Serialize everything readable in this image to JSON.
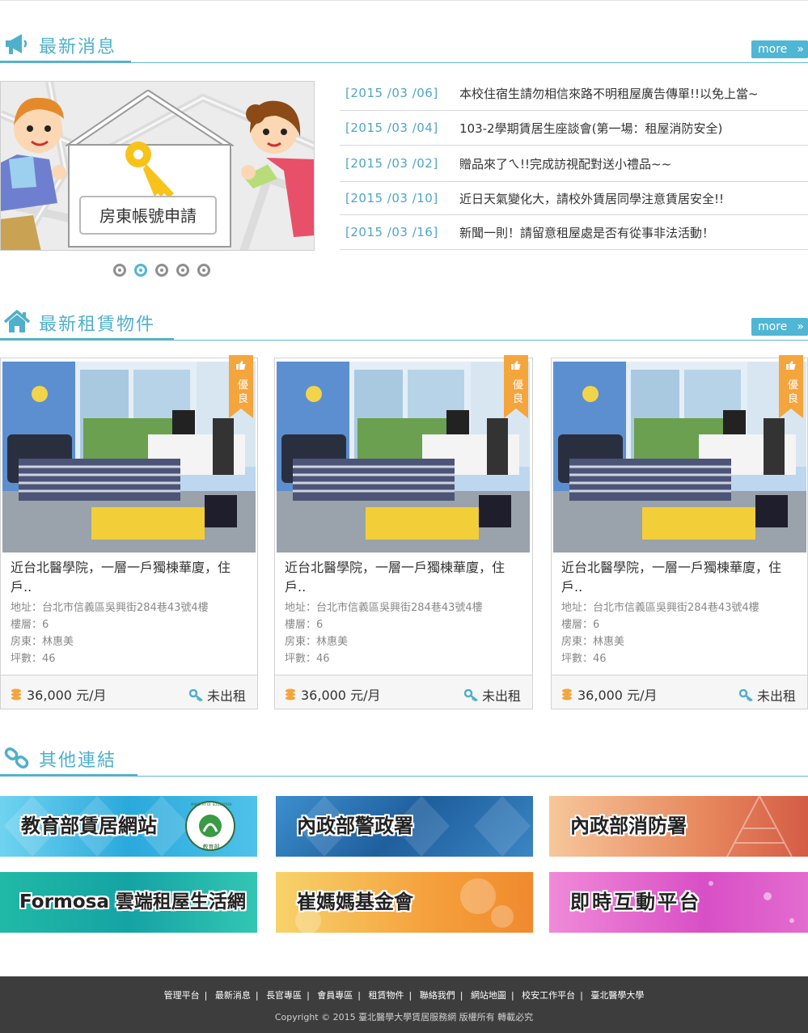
{
  "news_section": {
    "title": "最新消息",
    "more": "more",
    "banner": {
      "caption": "房東帳號申請"
    },
    "slider_dots": 5,
    "active_dot": 2,
    "items": [
      {
        "date": "[2015 /03 /06]",
        "text": "本校住宿生請勿相信來路不明租屋廣告傳單!!以免上當~"
      },
      {
        "date": "[2015 /03 /04]",
        "text": "103-2學期賃居生座談會(第一場：租屋消防安全)"
      },
      {
        "date": "[2015 /03 /02]",
        "text": "贈品來了ㄟ!!完成訪視配對送小禮品~~"
      },
      {
        "date": "[2015 /03 /10]",
        "text": "近日天氣變化大，請校外賃居同學注意賃居安全!!"
      },
      {
        "date": "[2015 /03 /16]",
        "text": "新聞一則！請留意租屋處是否有從事非法活動！"
      }
    ]
  },
  "rental_section": {
    "title": "最新租賃物件",
    "more": "more",
    "listings": [
      {
        "badge": [
          "優",
          "良"
        ],
        "title_line1": "近台北醫學院，一層一戶獨棟華廈，住",
        "title_line2": "戶..",
        "address": "地址：台北市信義區吳興街284巷43號4樓",
        "floor": "樓層：6",
        "landlord": "房東：林惠美",
        "area": "坪數：46",
        "price": "36,000 元/月",
        "status": "未出租"
      },
      {
        "badge": [
          "優",
          "良"
        ],
        "title_line1": "近台北醫學院，一層一戶獨棟華廈，住",
        "title_line2": "戶..",
        "address": "地址：台北市信義區吳興街284巷43號4樓",
        "floor": "樓層：6",
        "landlord": "房東：林惠美",
        "area": "坪數：46",
        "price": "36,000 元/月",
        "status": "未出租"
      },
      {
        "badge": [
          "優",
          "良"
        ],
        "title_line1": "近台北醫學院，一層一戶獨棟華廈，住",
        "title_line2": "戶..",
        "address": "地址：台北市信義區吳興街284巷43號4樓",
        "floor": "樓層：6",
        "landlord": "房東：林惠美",
        "area": "坪數：46",
        "price": "36,000 元/月",
        "status": "未出租"
      }
    ]
  },
  "links_section": {
    "title": "其他連結",
    "links": [
      {
        "label": "教育部賃居網站",
        "seal": "MINISTRY OF EDUCATION",
        "seal_sub": "教育部"
      },
      {
        "label": "內政部警政署"
      },
      {
        "label": "內政部消防署"
      },
      {
        "label": "Formosa 雲端租屋生活網"
      },
      {
        "label": "崔媽媽基金會"
      },
      {
        "label": "即時互動平台"
      }
    ]
  },
  "footer": {
    "nav": [
      "管理平台",
      "最新消息",
      "長官專區",
      "會員專區",
      "租賃物件",
      "聯絡我們",
      "網站地圖",
      "校安工作平台",
      "臺北醫學大學"
    ],
    "copyright": "Copyright © 2015 臺北醫學大學賃居服務網 版權所有 轉載必究"
  },
  "colors": {
    "accent": "#4fb0cb",
    "badge": "#f4a53c",
    "footer_bg": "#3d3d3d"
  }
}
